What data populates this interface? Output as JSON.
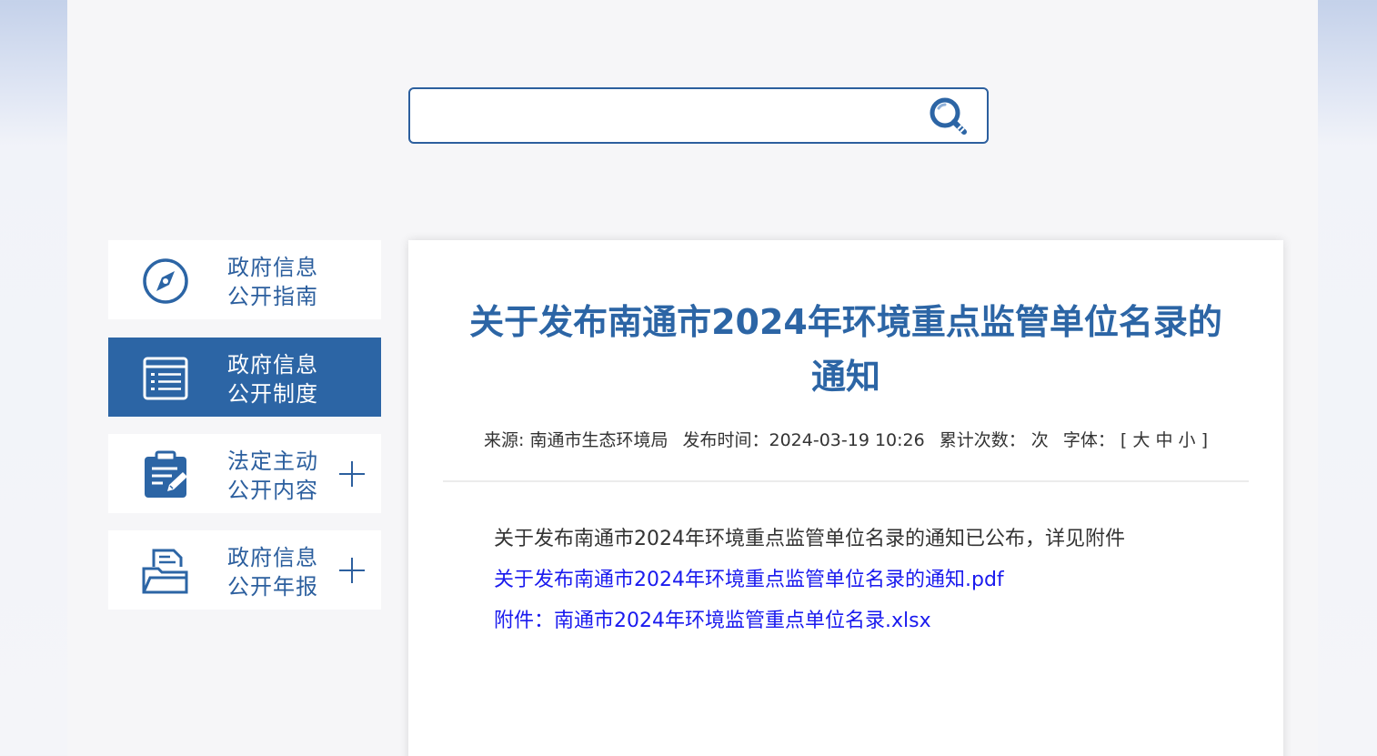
{
  "search": {
    "placeholder": ""
  },
  "sidebar": {
    "items": [
      {
        "line1": "政府信息",
        "line2": "公开指南",
        "icon": "compass-icon",
        "active": false,
        "expandable": false
      },
      {
        "line1": "政府信息",
        "line2": "公开制度",
        "icon": "list-icon",
        "active": true,
        "expandable": false
      },
      {
        "line1": "法定主动",
        "line2": "公开内容",
        "icon": "clipboard-edit-icon",
        "active": false,
        "expandable": true
      },
      {
        "line1": "政府信息",
        "line2": "公开年报",
        "icon": "folder-document-icon",
        "active": false,
        "expandable": true
      }
    ]
  },
  "article": {
    "title_line1": "关于发布南通市2024年环境重点监管单位名录的",
    "title_line2": "通知",
    "meta": {
      "source": "来源: 南通市生态环境局",
      "publish": "发布时间：2024-03-19 10:26",
      "views": "累计次数：  次",
      "font_label": "字体：",
      "font_open": "[",
      "font_large": "大",
      "font_medium": "中",
      "font_small": "小",
      "font_close": "]"
    },
    "body": "关于发布南通市2024年环境重点监管单位名录的通知已公布，详见附件",
    "attachments": [
      "关于发布南通市2024年环境重点监管单位名录的通知.pdf",
      "附件：南通市2024年环境监管重点单位名录.xlsx"
    ]
  },
  "colors": {
    "brand": "#2c65a5",
    "link": "#1a1aee",
    "text": "#333333"
  }
}
